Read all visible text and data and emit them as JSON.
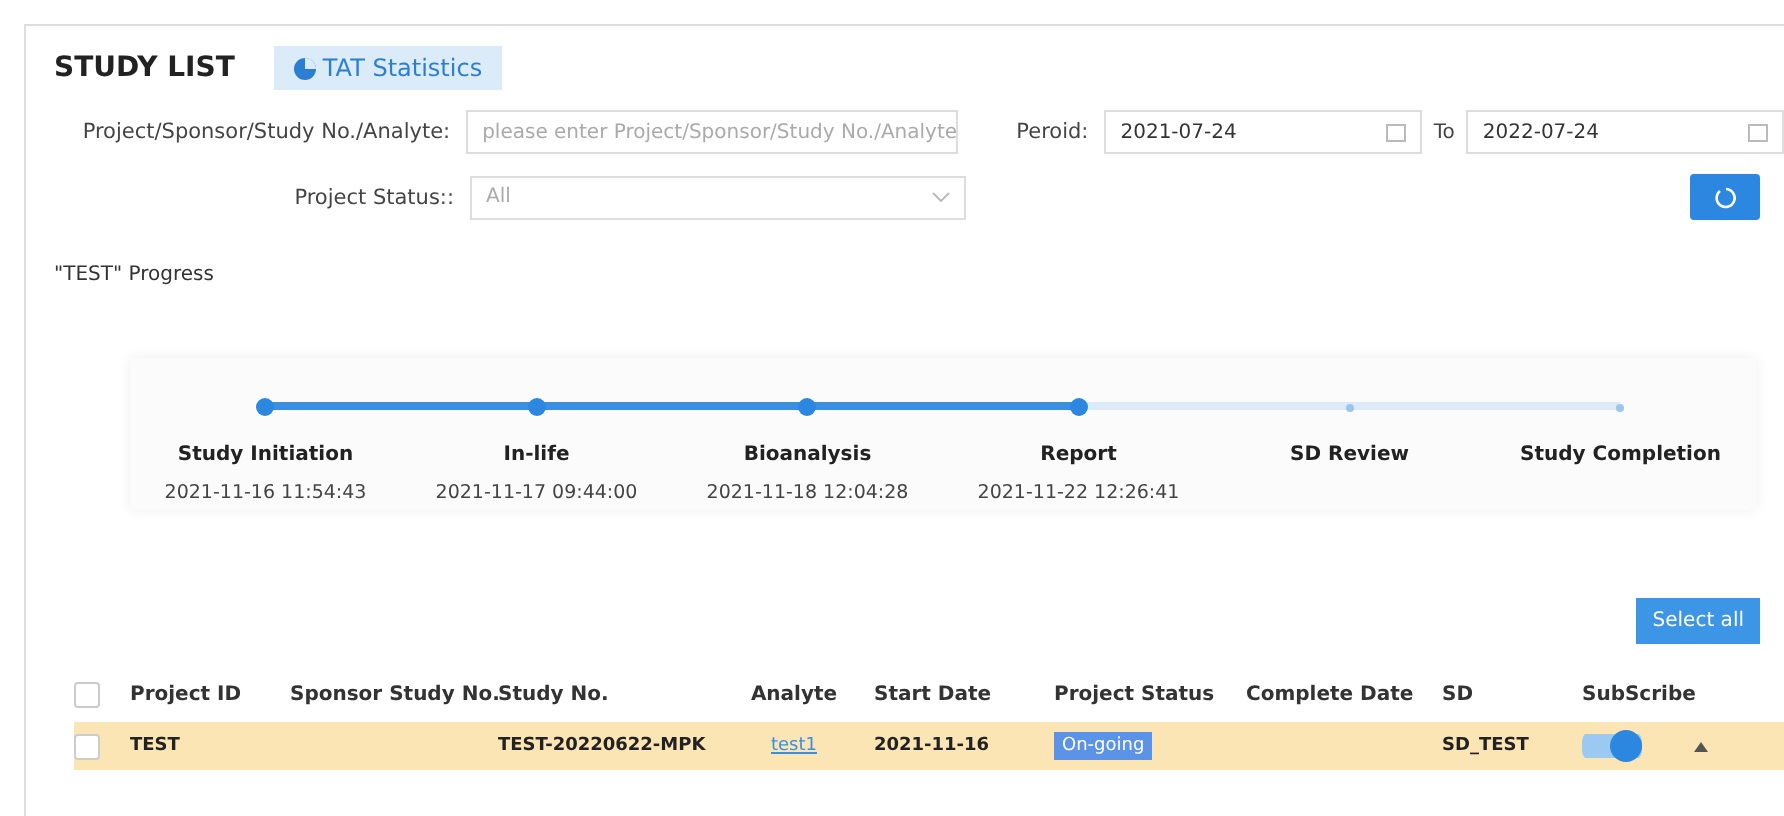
{
  "header": {
    "title": "STUDY LIST",
    "tab": "TAT Statistics"
  },
  "filters": {
    "search_label": "Project/Sponsor/Study No./Analyte:",
    "search_placeholder": "please enter Project/Sponsor/Study No./Analyte",
    "period_label": "Peroid:",
    "date_from": "2021-07-24",
    "to_label": "To",
    "date_to": "2022-07-24",
    "status_label": "Project Status::",
    "status_value": "All"
  },
  "progress": {
    "title": "\"TEST\" Progress",
    "steps": [
      {
        "label": "Study Initiation",
        "time": "2021-11-16 11:54:43",
        "done": true
      },
      {
        "label": "In-life",
        "time": "2021-11-17 09:44:00",
        "done": true
      },
      {
        "label": "Bioanalysis",
        "time": "2021-11-18 12:04:28",
        "done": true
      },
      {
        "label": "Report",
        "time": "2021-11-22 12:26:41",
        "done": true
      },
      {
        "label": "SD Review",
        "done": false
      },
      {
        "label": "Study Completion",
        "done": false
      }
    ]
  },
  "select_all": "Select all",
  "table": {
    "all_checked": false,
    "columns": [
      "Project ID",
      "Sponsor Study No.",
      "Study No.",
      "Analyte",
      "Start Date",
      "Project Status",
      "Complete Date",
      "SD",
      "SubScribe"
    ],
    "rows": [
      {
        "project_id": "TEST",
        "study_no": "TEST-20220622-MPK",
        "analyte": "test1",
        "start_date": "2021-11-16",
        "status": "On-going",
        "sd": "SD_TEST",
        "checked": false,
        "selected": true,
        "subscribed": true
      }
    ]
  }
}
